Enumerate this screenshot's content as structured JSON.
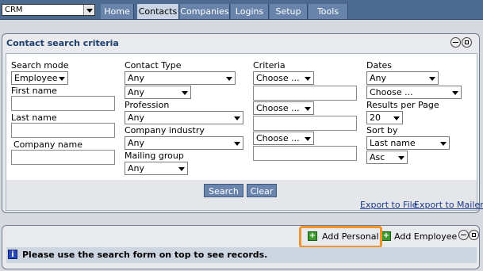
{
  "app_select": {
    "value": "CRM"
  },
  "nav": {
    "tabs": [
      {
        "label": "Home"
      },
      {
        "label": "Contacts"
      },
      {
        "label": "Companies"
      },
      {
        "label": "Logins"
      },
      {
        "label": "Setup"
      },
      {
        "label": "Tools"
      }
    ]
  },
  "search_panel": {
    "title": "Contact search criteria",
    "search_mode": {
      "label": "Search mode",
      "value": "Employee"
    },
    "first_name": {
      "label": "First name",
      "value": ""
    },
    "last_name": {
      "label": "Last name",
      "value": ""
    },
    "company_name": {
      "label": "Company name",
      "value": ""
    },
    "contact_type": {
      "label": "Contact Type",
      "value": "Any",
      "value2": "Any"
    },
    "profession": {
      "label": "Profession",
      "value": "Any"
    },
    "company_industry": {
      "label": "Company industry",
      "value": "Any"
    },
    "mailing_group": {
      "label": "Mailing group",
      "value": "Any"
    },
    "criteria": {
      "label": "Criteria",
      "rows": [
        {
          "value": "Choose ..."
        },
        {
          "value": "Choose ..."
        },
        {
          "value": "Choose ..."
        }
      ]
    },
    "dates": {
      "label": "Dates",
      "value": "Any",
      "value2": "Choose ..."
    },
    "results_per_page": {
      "label": "Results per Page",
      "value": "20"
    },
    "sort_by": {
      "label": "Sort by",
      "value": "Last name",
      "order": "Asc"
    },
    "search_button": "Search",
    "clear_button": "Clear",
    "export_file": "Export to File",
    "export_mailer": "Export to Mailer"
  },
  "results_panel": {
    "add_personal": "Add Personal",
    "add_employee": "Add Employee",
    "info_message": "Please use the search form on top to see records."
  },
  "colors": {
    "nav_bar": "#4d6a91",
    "highlight": "#f0952a",
    "button": "#6a86ad",
    "title": "#1e3e6e"
  }
}
